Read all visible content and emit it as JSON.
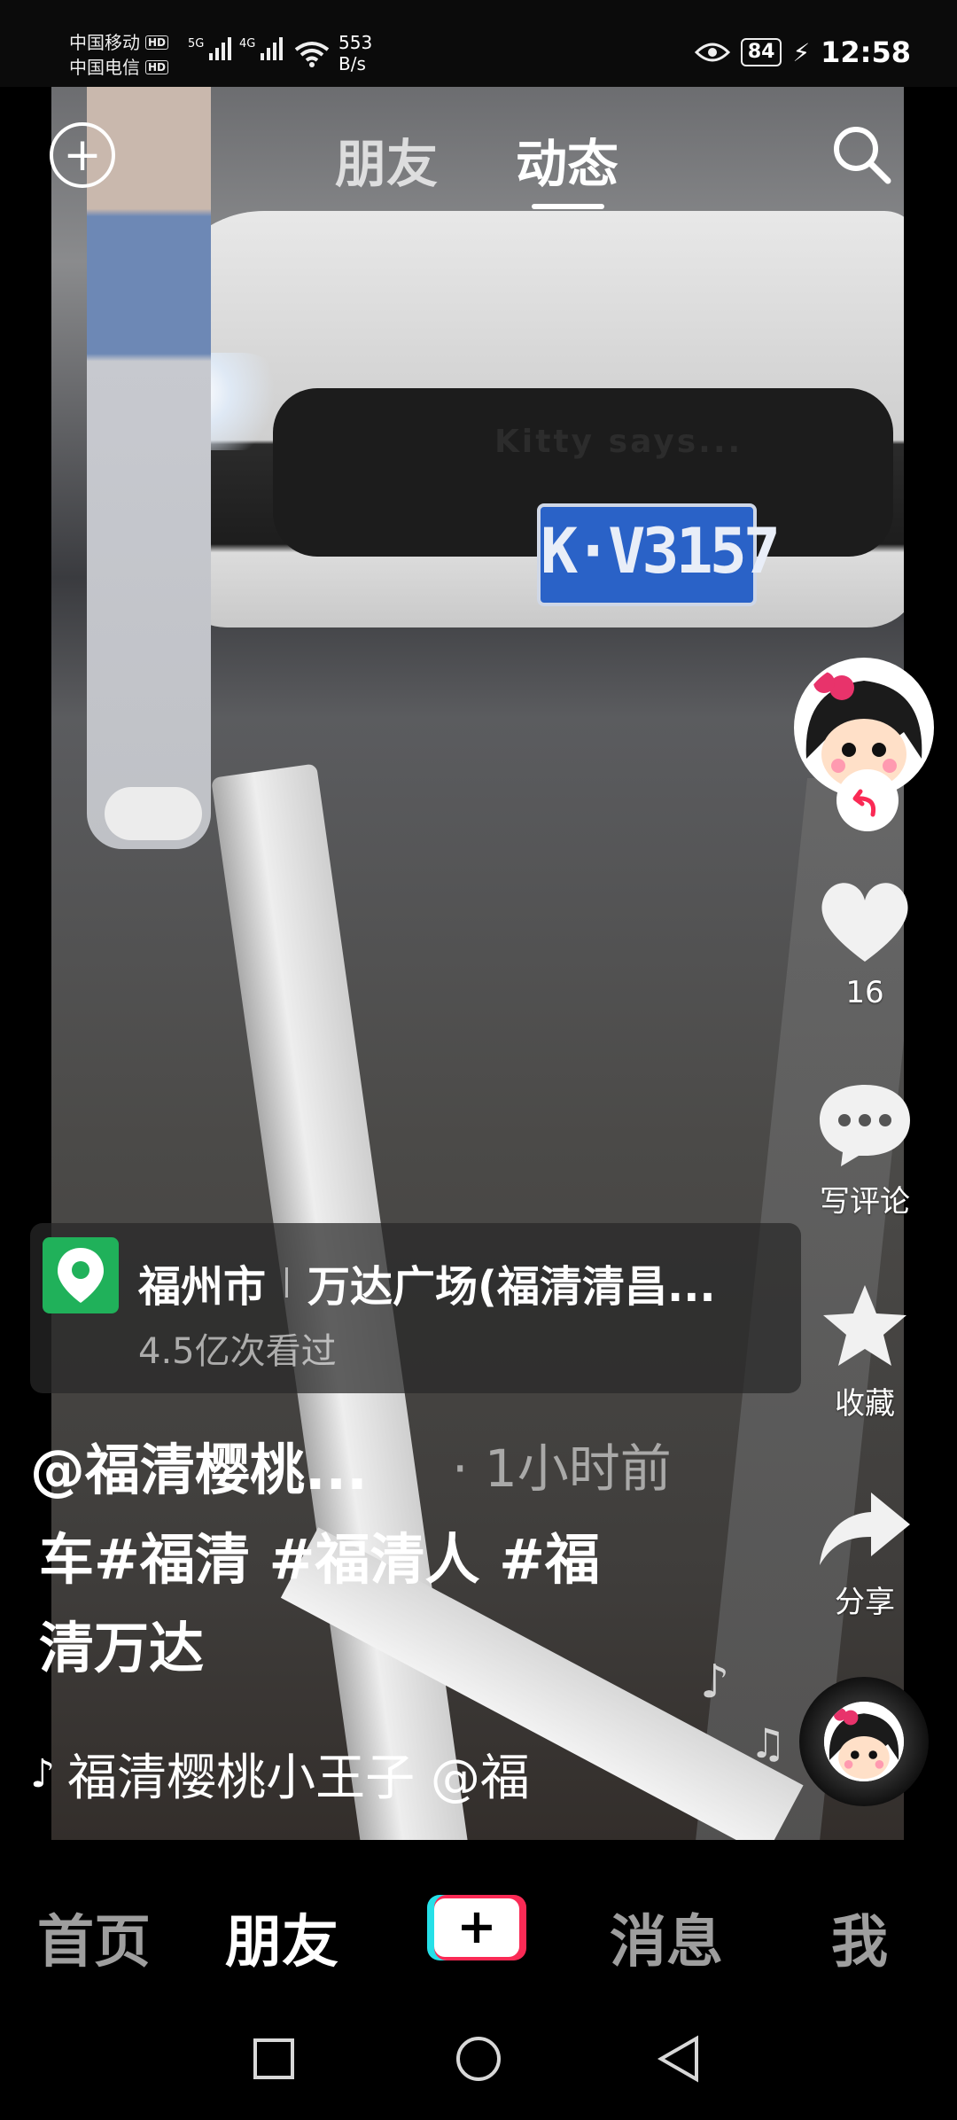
{
  "status_bar": {
    "carrier_1": "中国移动",
    "carrier_2": "中国电信",
    "hd": "HD",
    "net_1": "5G",
    "net_2": "4G",
    "speed_value": "553",
    "speed_unit": "B/s",
    "battery": "84",
    "time": "12:58"
  },
  "top_nav": {
    "tab_friends": "朋友",
    "tab_feed": "动态",
    "active_tab": "动态"
  },
  "video": {
    "plate": "K·V3157",
    "car_text": "Kitty says..."
  },
  "sidebar": {
    "like_count": "16",
    "comment_label": "写评论",
    "favorite_label": "收藏",
    "share_label": "分享"
  },
  "location": {
    "city": "福州市",
    "place": "万达广场(福清清昌...",
    "views": "4.5亿次看过"
  },
  "post": {
    "author": "@福清樱桃...",
    "time": "· 1小时前",
    "desc_line1": "车#福清 #福清人 #福",
    "desc_line2": "清万达",
    "music": "福清樱桃小王子    @福"
  },
  "bottom_nav": {
    "home": "首页",
    "friends": "朋友",
    "messages": "消息",
    "me": "我",
    "active": "朋友"
  },
  "icons": {
    "accent_location": "#20b15a",
    "accent_red": "#fa2a55",
    "accent_cyan": "#26e0e8"
  }
}
